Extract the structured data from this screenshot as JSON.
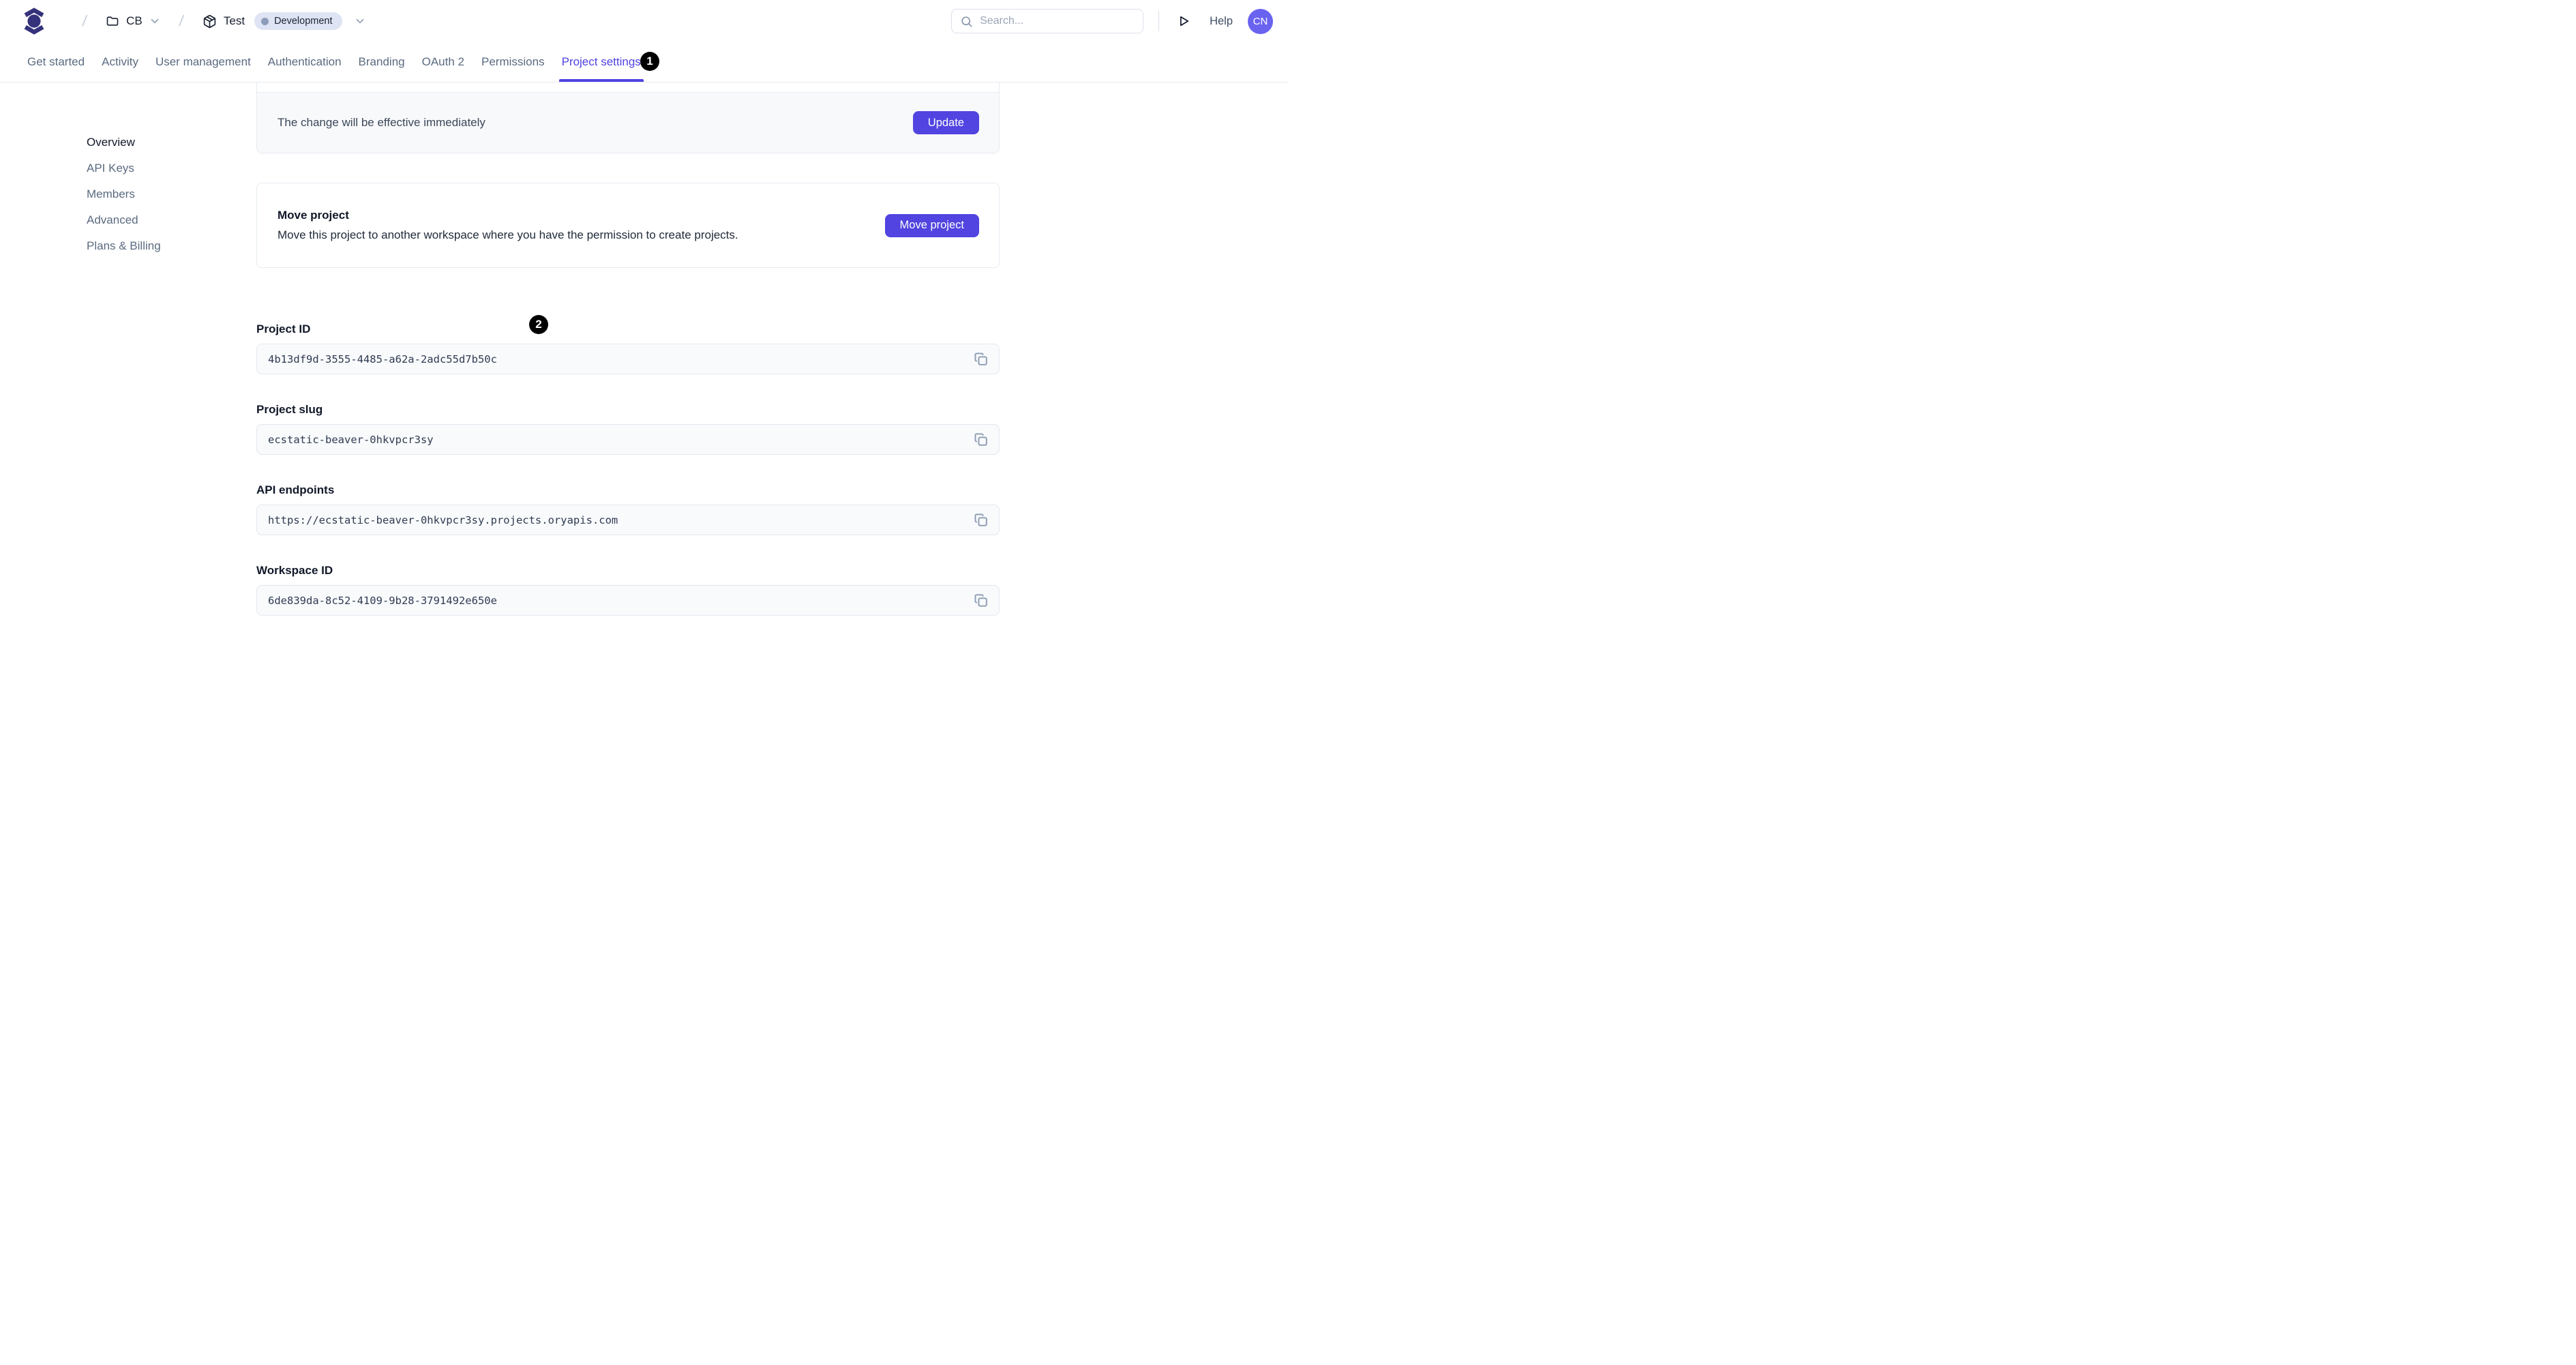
{
  "header": {
    "breadcrumb_separator": "/",
    "workspace": "CB",
    "project": "Test",
    "environment": "Development",
    "search_placeholder": "Search...",
    "help": "Help",
    "avatar_initials": "CN"
  },
  "tabs": {
    "items": [
      {
        "label": "Get started",
        "active": false
      },
      {
        "label": "Activity",
        "active": false
      },
      {
        "label": "User management",
        "active": false
      },
      {
        "label": "Authentication",
        "active": false
      },
      {
        "label": "Branding",
        "active": false
      },
      {
        "label": "OAuth 2",
        "active": false
      },
      {
        "label": "Permissions",
        "active": false
      },
      {
        "label": "Project settings",
        "active": true
      }
    ]
  },
  "sidebar": {
    "items": [
      {
        "label": "Overview",
        "active": true
      },
      {
        "label": "API Keys",
        "active": false
      },
      {
        "label": "Members",
        "active": false
      },
      {
        "label": "Advanced",
        "active": false
      },
      {
        "label": "Plans & Billing",
        "active": false
      }
    ]
  },
  "main": {
    "update_card": {
      "note": "The change will be effective immediately",
      "button": "Update"
    },
    "move_card": {
      "title": "Move project",
      "description": "Move this project to another workspace where you have the permission to create projects.",
      "button": "Move project"
    },
    "fields": [
      {
        "label": "Project ID",
        "value": "4b13df9d-3555-4485-a62a-2adc55d7b50c"
      },
      {
        "label": "Project slug",
        "value": "ecstatic-beaver-0hkvpcr3sy"
      },
      {
        "label": "API endpoints",
        "value": "https://ecstatic-beaver-0hkvpcr3sy.projects.oryapis.com"
      },
      {
        "label": "Workspace ID",
        "value": "6de839da-8c52-4109-9b28-3791492e650e"
      }
    ]
  },
  "annotations": [
    {
      "number": "1"
    },
    {
      "number": "2"
    }
  ],
  "icons": {
    "logo": "ory-logo",
    "breadcrumb_workspace": "folder-icon",
    "breadcrumb_project": "package-icon",
    "dropdowns": "chevron-down-icon",
    "search": "search-icon",
    "run": "play-icon",
    "copy": "copy-icon"
  },
  "colors": {
    "accent": "#5144e0",
    "active_tab": "#4f43e1",
    "logo": "#35327c",
    "avatar_bg": "#6a63f0",
    "env_badge_bg": "#dfe4f4",
    "annotation_bg": "#000000"
  }
}
